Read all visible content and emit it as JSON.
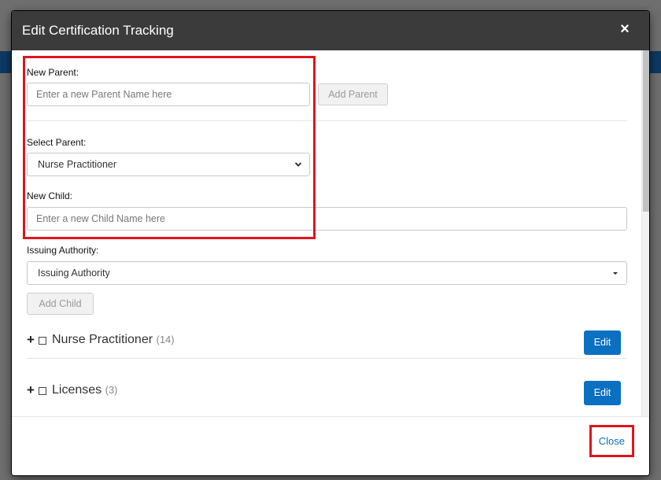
{
  "modal": {
    "title": "Edit Certification Tracking",
    "close_icon": "×"
  },
  "new_parent": {
    "label": "New Parent:",
    "placeholder": "Enter a new Parent Name here",
    "button": "Add Parent"
  },
  "select_parent": {
    "label": "Select Parent:",
    "selected": "Nurse Practitioner"
  },
  "new_child": {
    "label": "New Child:",
    "placeholder": "Enter a new Child Name here"
  },
  "issuing_authority": {
    "label": "Issuing Authority:",
    "selected": "Issuing Authority"
  },
  "add_child_button": "Add Child",
  "tree": [
    {
      "name": "Nurse Practitioner",
      "count": "(14)",
      "edit_label": "Edit"
    },
    {
      "name": "Licenses",
      "count": "(3)",
      "edit_label": "Edit"
    }
  ],
  "footer": {
    "close_label": "Close"
  },
  "colors": {
    "header": "#3b3b3b",
    "primary": "#0b6fc2",
    "highlight": "#e0141e"
  }
}
